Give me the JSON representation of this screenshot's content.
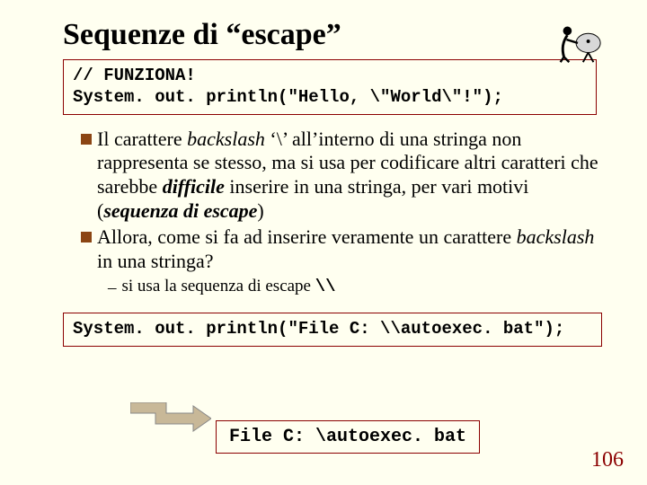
{
  "title": "Sequenze di “escape”",
  "code1_line1": "// FUNZIONA!",
  "code1_line2": "System. out. println(\"Hello, \\\"World\\\"!\");",
  "bullet1_pre": "Il carattere ",
  "bullet1_em1": "backslash",
  "bullet1_mid1": " ‘\\’ all’interno di una stringa non rappresenta se stesso, ma si usa per codificare altri caratteri che sarebbe ",
  "bullet1_em2": "difficile",
  "bullet1_mid2": " inserire in una stringa, per vari motivi (",
  "bullet1_em3": "sequenza di escape",
  "bullet1_end": ")",
  "bullet2_pre": "Allora, come si fa ad inserire veramente un carattere ",
  "bullet2_em1": "backslash",
  "bullet2_end": " in una stringa?",
  "sub1_pre": "si usa la sequenza di escape ",
  "sub1_mono": "\\\\",
  "code2": "System. out. println(\"File C: \\\\autoexec. bat\");",
  "output": "File C: \\autoexec. bat",
  "page": "106"
}
